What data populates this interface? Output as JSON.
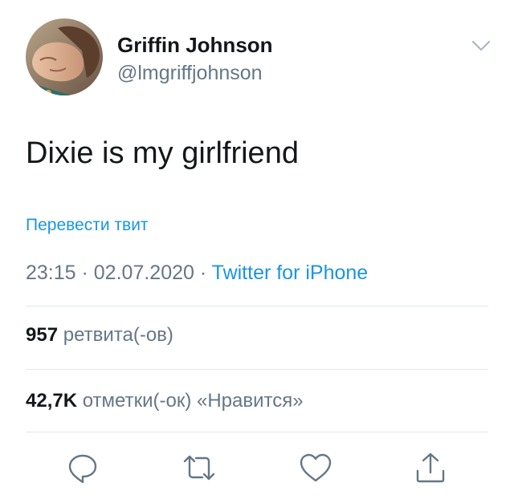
{
  "author": {
    "display_name": "Griffin Johnson",
    "handle": "@lmgriffjohnson"
  },
  "tweet": {
    "text": "Dixie is my girlfriend",
    "translate_label": "Перевести твит",
    "time": "23:15",
    "separator": " · ",
    "date": "02.07.2020",
    "source": "Twitter for iPhone"
  },
  "stats": {
    "retweets_count": "957",
    "retweets_label": "ретвита(-ов)",
    "likes_count": "42,7K",
    "likes_label": "отметки(-ок) «Нравится»"
  },
  "actions": {
    "icons": [
      "reply-icon",
      "retweet-icon",
      "like-icon",
      "share-icon"
    ]
  },
  "colors": {
    "text": "#14171a",
    "secondary": "#657786",
    "accent": "#1b95e0",
    "divider": "#e1e8ed"
  }
}
